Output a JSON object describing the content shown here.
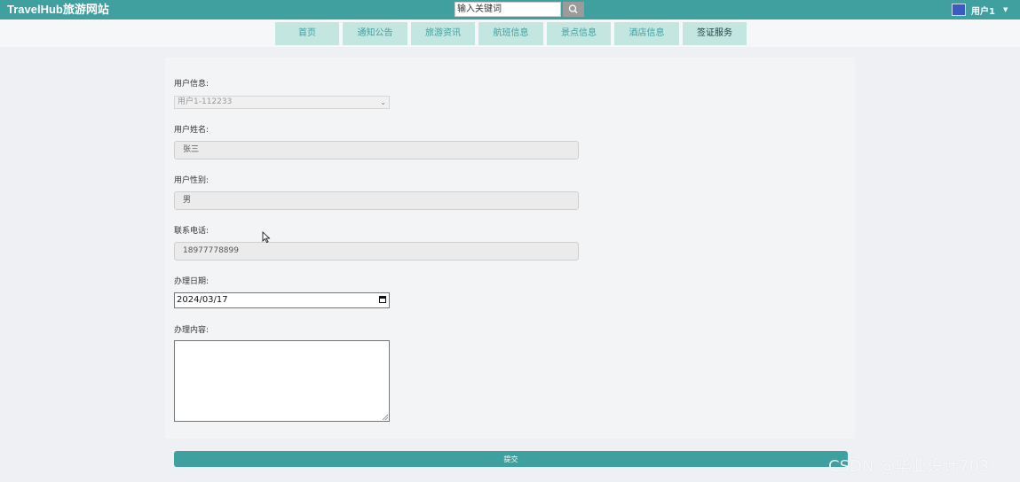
{
  "header": {
    "brand": "TravelHub旅游网站",
    "search_placeholder": "输入关键词",
    "user_name": "用户1",
    "colors": {
      "accent": "#40a0a0",
      "nav_bg": "#c3e6e1"
    }
  },
  "nav": {
    "items": [
      {
        "label": "首页"
      },
      {
        "label": "通知公告"
      },
      {
        "label": "旅游资讯"
      },
      {
        "label": "航班信息"
      },
      {
        "label": "景点信息"
      },
      {
        "label": "酒店信息"
      },
      {
        "label": "签证服务",
        "active": true
      }
    ]
  },
  "form": {
    "user_info_label": "用户信息:",
    "user_info_value": "用户1-112233",
    "name_label": "用户姓名:",
    "name_value": "张三",
    "gender_label": "用户性别:",
    "gender_value": "男",
    "phone_label": "联系电话:",
    "phone_value": "18977778899",
    "date_label": "办理日期:",
    "date_value": "2024/03/17",
    "content_label": "办理内容:",
    "content_value": "",
    "submit_label": "提交"
  },
  "watermark": "CSDN @毕业设计703",
  "icons": [
    "search-icon",
    "chevron-down-icon",
    "calendar-icon",
    "caret-down-icon",
    "mouse-cursor-icon"
  ]
}
